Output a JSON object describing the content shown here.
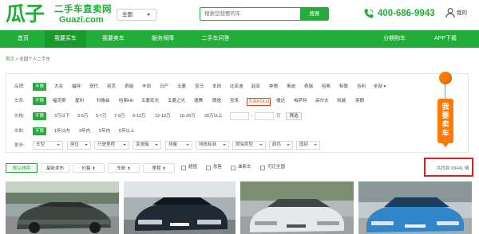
{
  "header": {
    "logo_text": "瓜子",
    "slogan": "二手车直卖网",
    "domain": "Guazi.com",
    "city": "全国",
    "search_placeholder": "搜索您想要的车",
    "search_button": "搜索",
    "phone": "400-686-9943",
    "mine": "我的"
  },
  "nav": {
    "items": [
      "首页",
      "我要买车",
      "我要卖车",
      "服务保障",
      "二手车问答",
      "分期购车",
      "APP下载"
    ],
    "active": "我要买车"
  },
  "breadcrumb": {
    "home": "首页",
    "separator": ">",
    "current": "全国个人二手车"
  },
  "filters": {
    "brand": {
      "label": "品牌:",
      "options": [
        "不限",
        "大众",
        "福特",
        "现代",
        "别克",
        "奇瑞",
        "丰田",
        "日产",
        "五菱",
        "宝马",
        "本田",
        "比亚迪",
        "起亚",
        "奔驰",
        "奥迪",
        "奇瑞",
        "哈弗",
        "标致",
        "吉利",
        "全部"
      ]
    },
    "series": {
      "label": "车系:",
      "options": [
        "不限",
        "福克斯",
        "夏利",
        "科鲁兹",
        "哈弗H6",
        "五菱宏光",
        "五菱之光",
        "速腾",
        "朗逸",
        "宝来",
        "大众POLO",
        "捷达",
        "帕萨特",
        "高尔夫",
        "凯越",
        "英朗"
      ],
      "highlighted": "大众POLO"
    },
    "price": {
      "label": "价格:",
      "options": [
        "不限",
        "3万以下",
        "3-5万",
        "5-7万",
        "7-9万",
        "9-12万",
        "12-16万",
        "16-20万",
        "20万以上"
      ],
      "unit": "万",
      "separator": "-",
      "button": "筛选"
    },
    "age": {
      "label": "车龄:",
      "options": [
        "不限",
        "1年以内",
        "3年内",
        "5年内",
        "5年以上"
      ]
    },
    "more": {
      "label": "更多:",
      "dropdowns": [
        "车型",
        "座位",
        "行驶里程",
        "变速箱",
        "排量",
        "排放标准",
        "燃油类型",
        "颜色",
        "国别"
      ]
    }
  },
  "sell_badge": [
    "我",
    "要",
    "卖",
    "车"
  ],
  "sort": {
    "buttons": [
      "默认排序",
      "最新发布",
      "价格",
      "车龄",
      "里程"
    ],
    "active": "默认排序",
    "checkboxes": [
      "超值",
      "急售",
      "准新车",
      "可迁全国"
    ],
    "count_prefix": "共找到",
    "count": "99441",
    "count_suffix": "辆"
  },
  "colors": {
    "brand_green": "#22ac38",
    "accent_orange": "#ff7a00",
    "highlight_red": "#e02020"
  }
}
